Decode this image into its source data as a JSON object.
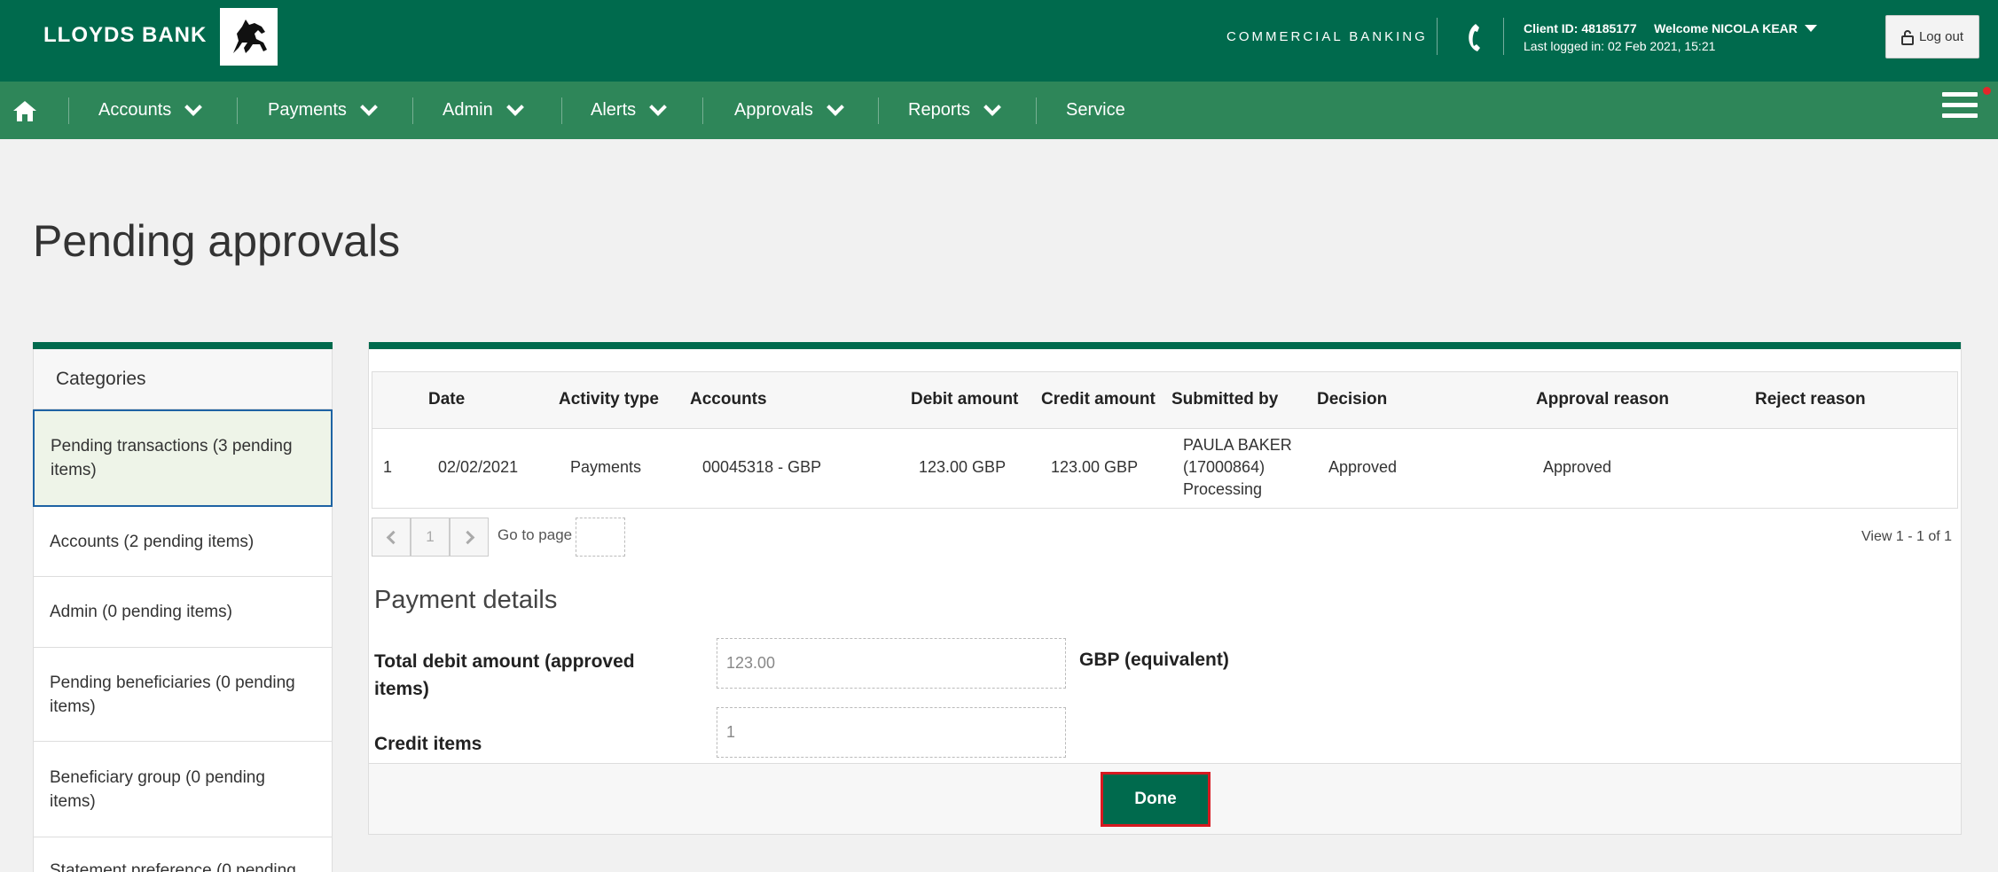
{
  "header": {
    "brand": "LLOYDS BANK",
    "section": "COMMERCIAL BANKING",
    "client_id": "Client ID: 48185177",
    "welcome": "Welcome NICOLA KEAR",
    "last_logged": "Last logged in: 02 Feb 2021, 15:21",
    "logout_label": "Log out"
  },
  "nav": {
    "items": [
      {
        "label": "Accounts"
      },
      {
        "label": "Payments"
      },
      {
        "label": "Admin"
      },
      {
        "label": "Alerts"
      },
      {
        "label": "Approvals"
      },
      {
        "label": "Reports"
      },
      {
        "label": "Service"
      }
    ]
  },
  "page": {
    "title": "Pending approvals"
  },
  "sidebar": {
    "heading": "Categories",
    "items": [
      {
        "label": "Pending transactions (3 pending items)",
        "active": true
      },
      {
        "label": "Accounts (2 pending items)"
      },
      {
        "label": "Admin (0 pending items)"
      },
      {
        "label": "Pending beneficiaries (0 pending items)"
      },
      {
        "label": "Beneficiary group (0 pending items)"
      },
      {
        "label": "Statement preference (0 pending"
      }
    ]
  },
  "table": {
    "headers": [
      "Date",
      "Activity type",
      "Accounts",
      "Debit amount",
      "Credit amount",
      "Submitted by",
      "Decision",
      "Approval reason",
      "Reject reason"
    ],
    "rows": [
      {
        "index": "1",
        "date": "02/02/2021",
        "activity": "Payments",
        "account": "00045318 - GBP",
        "debit": "123.00 GBP",
        "credit": "123.00 GBP",
        "submitted_name": "PAULA BAKER",
        "submitted_id": "(17000864)",
        "submitted_status": "Processing",
        "decision": "Approved",
        "approval_reason": "Approved",
        "reject_reason": ""
      }
    ]
  },
  "pager": {
    "current_page": "1",
    "goto_label": "Go to page",
    "view_info": "View 1 - 1 of 1"
  },
  "payment_details": {
    "title": "Payment details",
    "total_debit_label": "Total debit amount (approved items)",
    "total_debit_value": "123.00",
    "currency_label": "GBP (equivalent)",
    "credit_items_label": "Credit items",
    "credit_items_value": "1"
  },
  "actions": {
    "done_label": "Done"
  },
  "colors": {
    "brand_green": "#006a4d",
    "nav_green": "#2e8659",
    "highlight_red": "#d71920"
  }
}
